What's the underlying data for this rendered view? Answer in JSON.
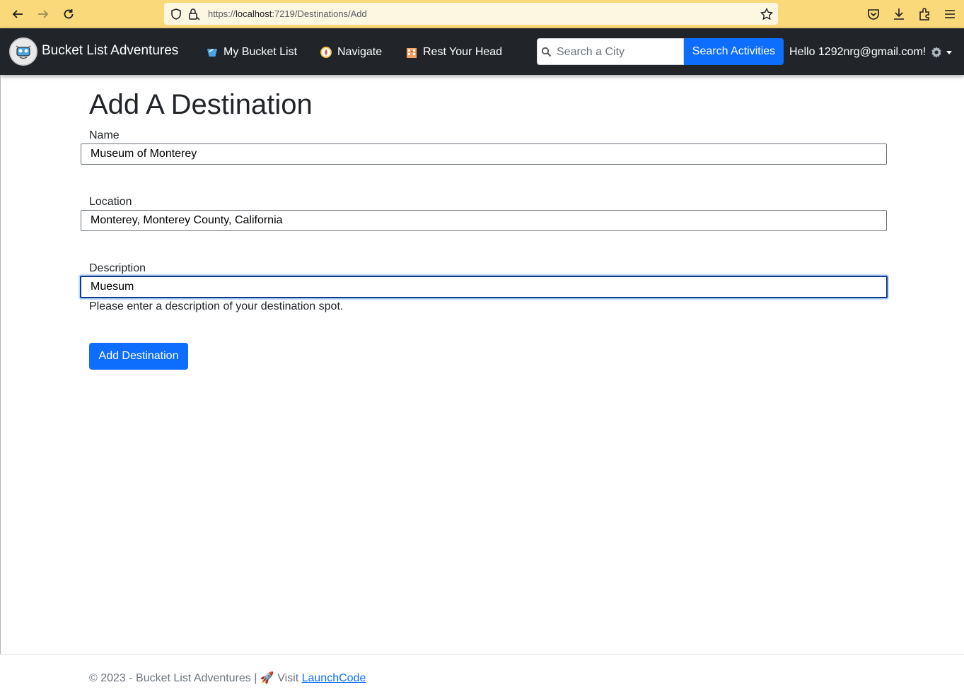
{
  "browser": {
    "url_prefix": "https://",
    "url_host": "localhost",
    "url_rest": ":7219/Destinations/Add"
  },
  "navbar": {
    "brand": "Bucket List Adventures",
    "links": [
      {
        "label": "My Bucket List",
        "icon": "bucket-icon"
      },
      {
        "label": "Navigate",
        "icon": "compass-icon"
      },
      {
        "label": "Rest Your Head",
        "icon": "hotel-icon"
      }
    ],
    "search_placeholder": "Search a City",
    "search_button": "Search Activities",
    "greeting": "Hello 1292nrg@gmail.com!"
  },
  "main": {
    "title": "Add A Destination",
    "fields": {
      "name": {
        "label": "Name",
        "value": "Museum of Monterey"
      },
      "location": {
        "label": "Location",
        "value": "Monterey, Monterey County, California"
      },
      "description": {
        "label": "Description",
        "value": "Muesum",
        "help": "Please enter a description of your destination spot."
      }
    },
    "submit_label": "Add Destination"
  },
  "footer": {
    "copyright": "© 2023 - Bucket List Adventures | ",
    "rocket": "🚀",
    "visit": " Visit ",
    "link": "LaunchCode"
  },
  "colors": {
    "browser_bar": "#f9d97a",
    "navbar": "#212529",
    "primary": "#0d6efd"
  }
}
